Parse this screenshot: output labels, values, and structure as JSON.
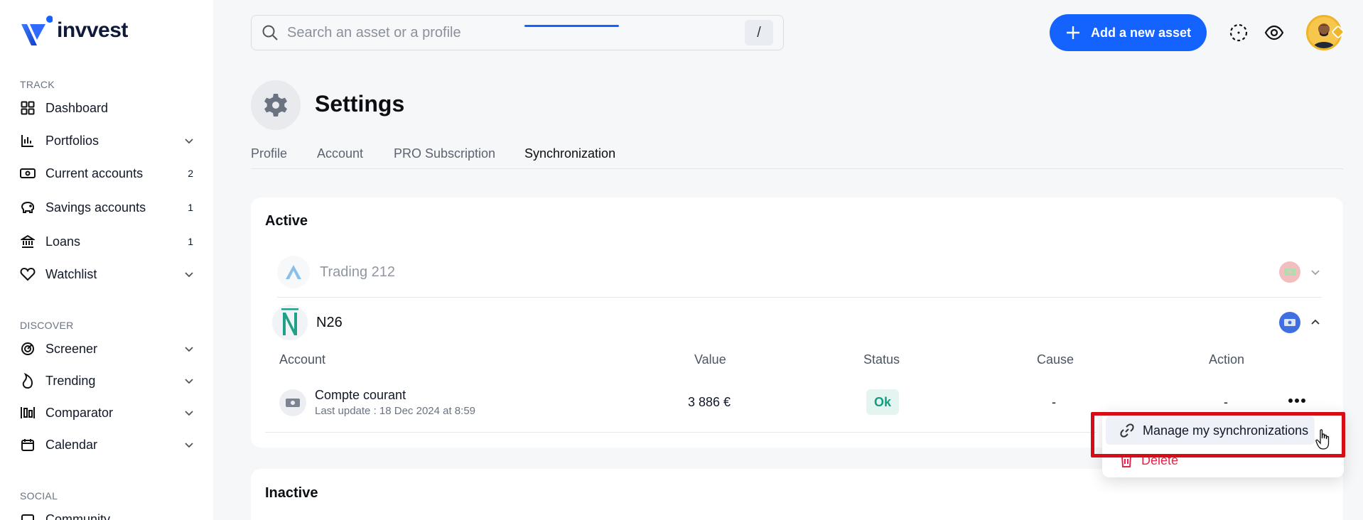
{
  "brand": {
    "name": "invvest"
  },
  "sidebar": {
    "sections": {
      "track": "TRACK",
      "discover": "DISCOVER",
      "social": "SOCIAL"
    },
    "items": [
      {
        "label": "Dashboard",
        "icon": "grid-icon"
      },
      {
        "label": "Portfolios",
        "icon": "bar-chart-icon"
      },
      {
        "label": "Current accounts",
        "icon": "cash-icon",
        "count": "2"
      },
      {
        "label": "Savings accounts",
        "icon": "piggy-bank-icon",
        "count": "1"
      },
      {
        "label": "Loans",
        "icon": "bank-icon",
        "count": "1"
      },
      {
        "label": "Watchlist",
        "icon": "heart-icon"
      },
      {
        "label": "Screener",
        "icon": "radar-icon"
      },
      {
        "label": "Trending",
        "icon": "flame-icon"
      },
      {
        "label": "Comparator",
        "icon": "compare-icon"
      },
      {
        "label": "Calendar",
        "icon": "calendar-icon"
      },
      {
        "label": "Community",
        "icon": "community-icon"
      }
    ]
  },
  "topbar": {
    "search_placeholder": "Search an asset or a profile",
    "shortcut_key": "/",
    "add_button": "Add a new asset"
  },
  "page": {
    "title": "Settings",
    "tabs": [
      "Profile",
      "Account",
      "PRO Subscription",
      "Synchronization"
    ],
    "active_tab": "Synchronization"
  },
  "active_section": {
    "title": "Active",
    "institutions": [
      {
        "name": "Trading 212"
      },
      {
        "name": "N26"
      }
    ],
    "table": {
      "headers": [
        "Account",
        "Value",
        "Status",
        "Cause",
        "Action"
      ],
      "rows": [
        {
          "account": "Compte courant",
          "last_update": "Last update : 18 Dec 2024 at 8:59",
          "value": "3 886 €",
          "status": "Ok",
          "cause": "-",
          "action": "-"
        }
      ]
    }
  },
  "menu": {
    "manage": "Manage my synchronizations",
    "delete": "Delete"
  },
  "inactive_section": {
    "title": "Inactive"
  },
  "colors": {
    "accent": "#1463ff",
    "status_ok": "#0f9f80",
    "danger": "#e0294a",
    "highlight": "#d60d17"
  }
}
